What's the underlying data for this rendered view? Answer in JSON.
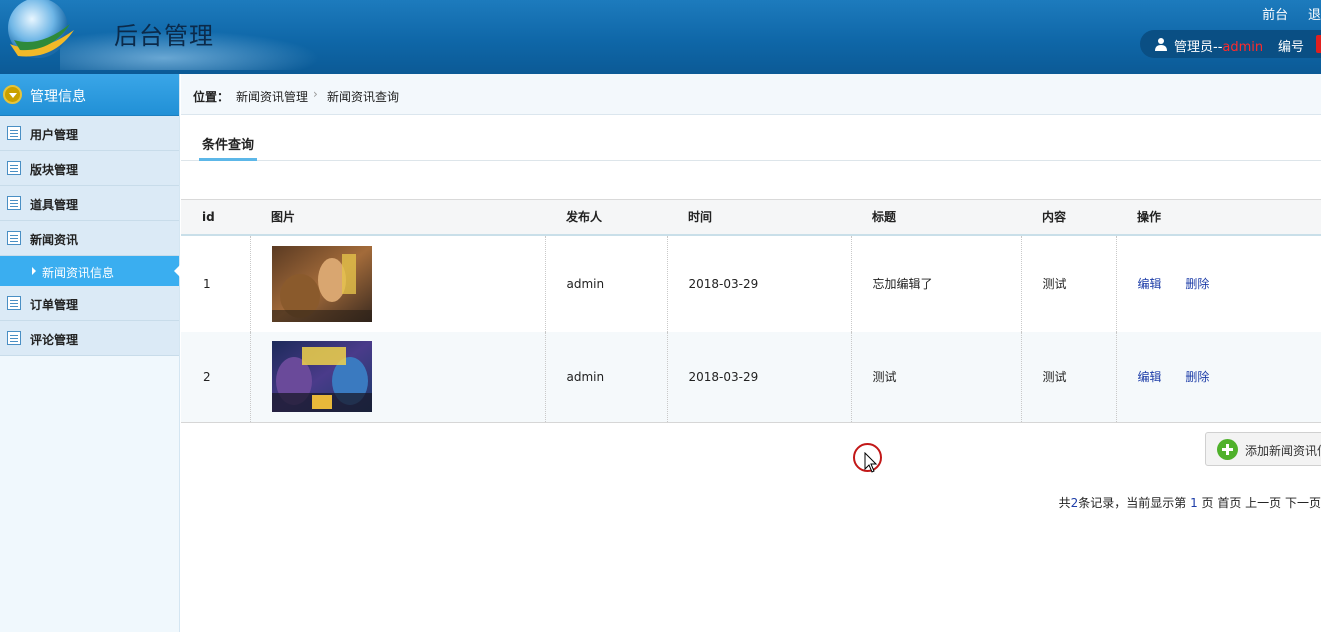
{
  "header": {
    "title": "后台管理",
    "links": [
      "前台",
      "退"
    ],
    "user_label": "管理员--",
    "user_name": "admin",
    "user_no_label": "编号"
  },
  "sidebar": {
    "heading": "管理信息",
    "items": [
      {
        "label": "用户管理"
      },
      {
        "label": "版块管理"
      },
      {
        "label": "道具管理"
      },
      {
        "label": "新闻资讯"
      },
      {
        "label": "订单管理"
      },
      {
        "label": "评论管理"
      }
    ],
    "active_sub": "新闻资讯信息"
  },
  "breadcrumb": {
    "prefix": "位置：",
    "items": [
      "新闻资讯管理",
      "新闻资讯查询"
    ]
  },
  "tab": {
    "label": "条件查询"
  },
  "table": {
    "headers": [
      "id",
      "图片",
      "发布人",
      "时间",
      "标题",
      "内容",
      "操作"
    ],
    "rows": [
      {
        "id": "1",
        "publisher": "admin",
        "time": "2018-03-29",
        "title": "忘加编辑了",
        "content": "测试",
        "edit": "编辑",
        "delete": "删除"
      },
      {
        "id": "2",
        "publisher": "admin",
        "time": "2018-03-29",
        "title": "测试",
        "content": "测试",
        "edit": "编辑",
        "delete": "删除"
      }
    ]
  },
  "add_button": {
    "label": "添加新闻资讯信"
  },
  "pager": {
    "prefix": "共",
    "count": "2",
    "mid": "条记录，当前显示第",
    "page": "1",
    "suffix": "页 首页 上一页 下一页"
  },
  "colors": {
    "accent": "#2190d6",
    "link": "#1d3da8",
    "brand_red": "#ff2a2a"
  }
}
